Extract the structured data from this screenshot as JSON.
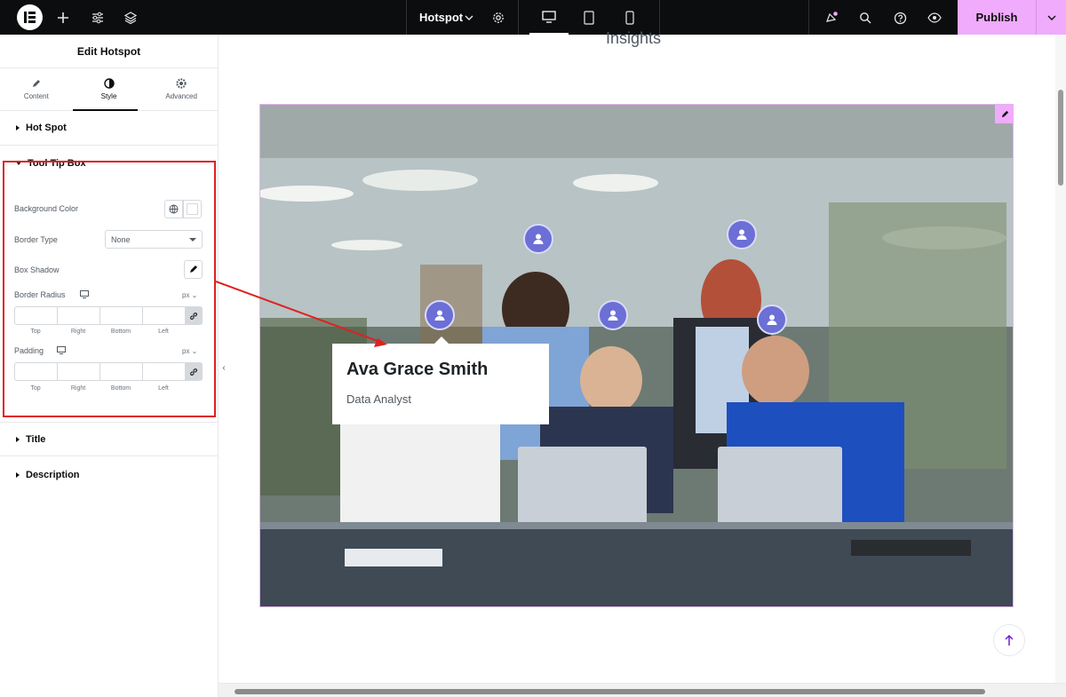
{
  "topbar": {
    "document_name": "Hotspot",
    "publish_label": "Publish",
    "icons": [
      "elementor-logo-icon",
      "add-icon",
      "sliders-icon",
      "layers-icon",
      "chevron-down-icon",
      "settings-icon",
      "desktop-icon",
      "tablet-icon",
      "mobile-icon",
      "notifications-icon",
      "search-icon",
      "help-icon",
      "preview-eye-icon",
      "chevron-down-icon"
    ]
  },
  "panel": {
    "title": "Edit Hotspot",
    "tabs": [
      {
        "label": "Content",
        "icon": "pencil-icon"
      },
      {
        "label": "Style",
        "icon": "contrast-icon",
        "active": true
      },
      {
        "label": "Advanced",
        "icon": "gear-icon"
      }
    ],
    "sections": {
      "hot_spot": "Hot Spot",
      "tool_tip_box": "Tool Tip Box",
      "title": "Title",
      "description": "Description"
    },
    "controls": {
      "background_color": "Background Color",
      "border_type": "Border Type",
      "border_type_value": "None",
      "box_shadow": "Box Shadow",
      "border_radius": "Border Radius",
      "padding": "Padding",
      "unit": "px",
      "dims": [
        "Top",
        "Right",
        "Bottom",
        "Left"
      ]
    }
  },
  "preview": {
    "heading": "Insights",
    "tooltip": {
      "title": "Ava Grace Smith",
      "description": "Data Analyst"
    }
  },
  "colors": {
    "topbar_bg": "#0c0d0e",
    "publish_bg": "#f0abfc",
    "hotspot": "#6b6fd6",
    "highlight": "#e02020"
  }
}
